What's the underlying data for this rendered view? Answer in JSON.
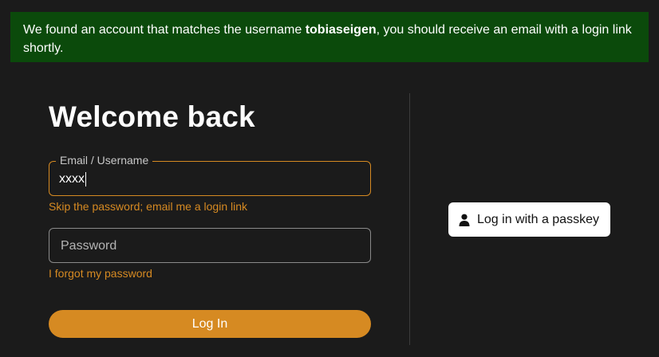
{
  "banner": {
    "text_before": "We found an account that matches the username ",
    "username": "tobiaseigen",
    "text_after": ", you should receive an email with a login link shortly."
  },
  "login": {
    "title": "Welcome back",
    "email_label": "Email / Username",
    "email_value": "xxxx",
    "skip_password_link": "Skip the password; email me a login link",
    "password_placeholder": "Password",
    "forgot_password_link": "I forgot my password",
    "login_button": "Log In"
  },
  "passkey": {
    "button_label": "Log in with a passkey",
    "icon": "user-icon"
  },
  "colors": {
    "background": "#1b1b1b",
    "banner": "#0b4a0b",
    "accent": "#d68a22"
  }
}
